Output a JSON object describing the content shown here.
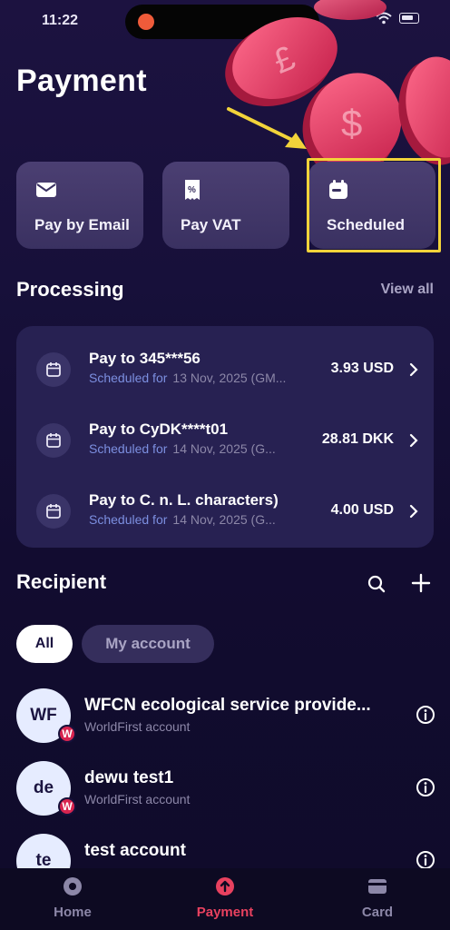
{
  "status_bar": {
    "time": "11:22"
  },
  "header": {
    "title": "Payment"
  },
  "actions": [
    {
      "label": "Pay by Email",
      "icon": "envelope-icon"
    },
    {
      "label": "Pay VAT",
      "icon": "vat-receipt-icon"
    },
    {
      "label": "Scheduled",
      "icon": "calendar-icon"
    }
  ],
  "processing": {
    "title": "Processing",
    "view_all": "View all",
    "items": [
      {
        "title": "Pay to 345***56",
        "scheduled_label": "Scheduled for",
        "date": "13 Nov, 2025 (GM...",
        "amount": "3.93 USD"
      },
      {
        "title": "Pay to CyDK****t01",
        "scheduled_label": "Scheduled for",
        "date": "14 Nov, 2025 (G...",
        "amount": "28.81 DKK"
      },
      {
        "title": "Pay to C. n. L. characters)",
        "scheduled_label": "Scheduled for",
        "date": "14 Nov, 2025 (G...",
        "amount": "4.00 USD"
      }
    ]
  },
  "recipient": {
    "title": "Recipient",
    "filters": {
      "all": "All",
      "my_account": "My account"
    },
    "items": [
      {
        "initials": "WF",
        "name": "WFCN ecological service provide...",
        "sub": "WorldFirst account",
        "badge": "W"
      },
      {
        "initials": "de",
        "name": "dewu test1",
        "sub": "WorldFirst account",
        "badge": "W"
      },
      {
        "initials": "te",
        "name": "test account",
        "sub": "",
        "badge": ""
      }
    ]
  },
  "bottom_nav": {
    "home": "Home",
    "payment": "Payment",
    "card": "Card"
  },
  "colors": {
    "accent": "#e8415f",
    "highlight": "#f2d33a",
    "scheduled_text": "#7c8fe0",
    "background": "#17103a"
  }
}
